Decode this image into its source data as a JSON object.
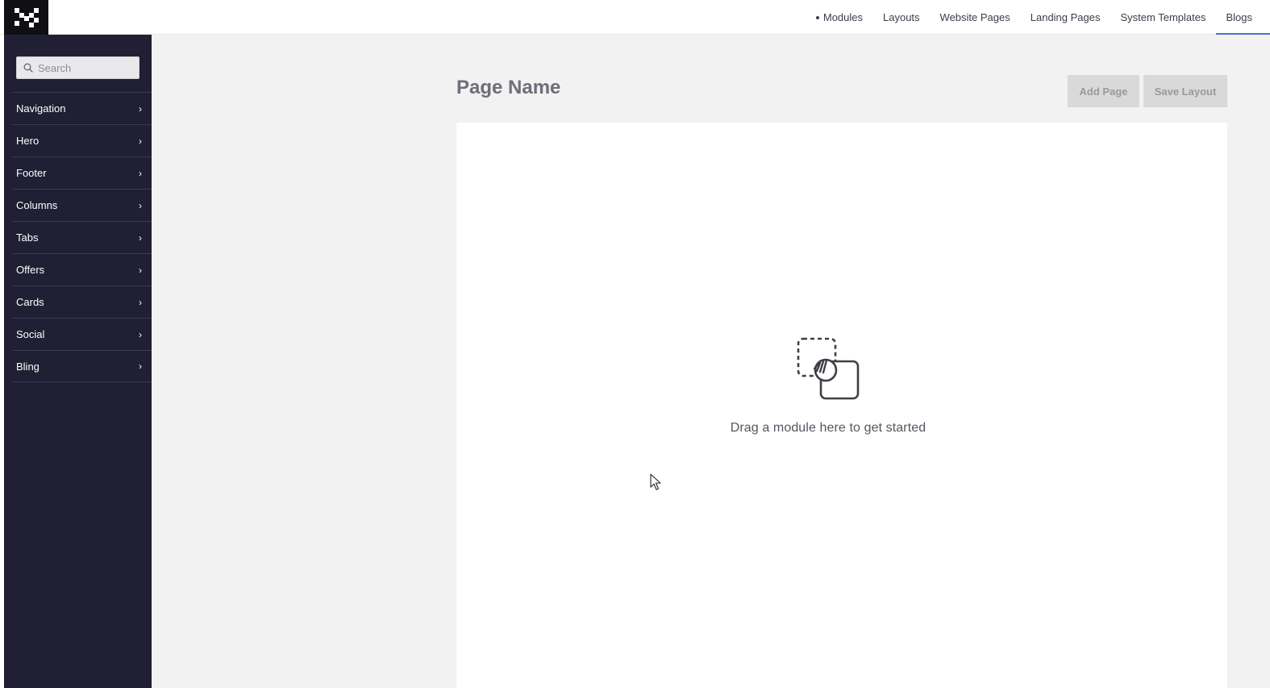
{
  "topnav": {
    "items": [
      {
        "label": "Modules",
        "current": true
      },
      {
        "label": "Layouts"
      },
      {
        "label": "Website Pages"
      },
      {
        "label": "Landing Pages"
      },
      {
        "label": "System Templates"
      },
      {
        "label": "Blogs",
        "active": true
      }
    ]
  },
  "sidebar": {
    "search_placeholder": "Search",
    "items": [
      {
        "label": "Navigation"
      },
      {
        "label": "Hero"
      },
      {
        "label": "Footer"
      },
      {
        "label": "Columns"
      },
      {
        "label": "Tabs"
      },
      {
        "label": "Offers"
      },
      {
        "label": "Cards"
      },
      {
        "label": "Social"
      },
      {
        "label": "Bling"
      }
    ]
  },
  "main": {
    "page_title": "Page Name",
    "add_page_label": "Add Page",
    "save_layout_label": "Save Layout",
    "empty_state_text": "Drag a module here to get started"
  },
  "colors": {
    "sidebar_bg": "#201f33",
    "active_underline": "#4a6fd8",
    "button_disabled_bg": "#d9d9d9"
  },
  "icons": {
    "logo": "checker-logo-icon",
    "search": "search-icon",
    "chevron": "chevron-right-icon",
    "empty_state": "drag-module-icon",
    "cursor": "mouse-pointer-icon"
  }
}
